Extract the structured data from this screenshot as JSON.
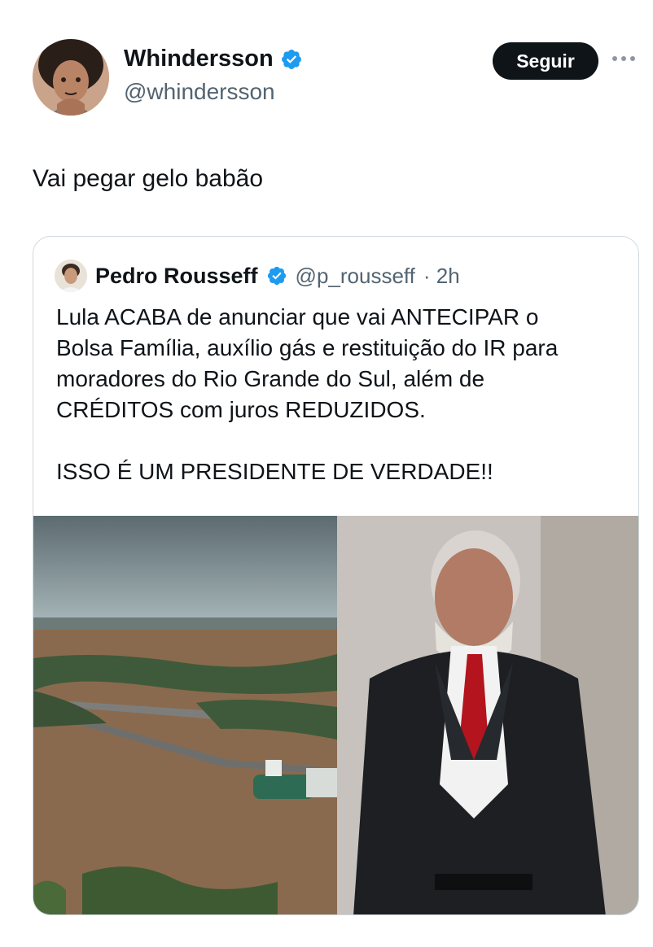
{
  "tweet": {
    "author_name": "Whindersson",
    "author_handle": "@whindersson",
    "follow_label": "Seguir",
    "text": "Vai pegar gelo babão"
  },
  "quoted": {
    "author_name": "Pedro Rousseff",
    "author_handle": "@p_rousseff",
    "time": "· 2h",
    "text": "Lula ACABA de anunciar que vai ANTECIPAR o\nBolsa Família, auxílio gás e restituição do IR para\nmoradores do Rio Grande do Sul, além de\nCRÉDITOS com juros REDUZIDOS.\n\nISSO É UM PRESIDENTE DE VERDADE!!"
  },
  "icons": {
    "verified": "verified-badge-icon",
    "more": "more-icon"
  },
  "colors": {
    "verified": "#1d9bf0",
    "follow_bg": "#0f1419",
    "border": "#cfd9de",
    "secondary_text": "#536471"
  }
}
